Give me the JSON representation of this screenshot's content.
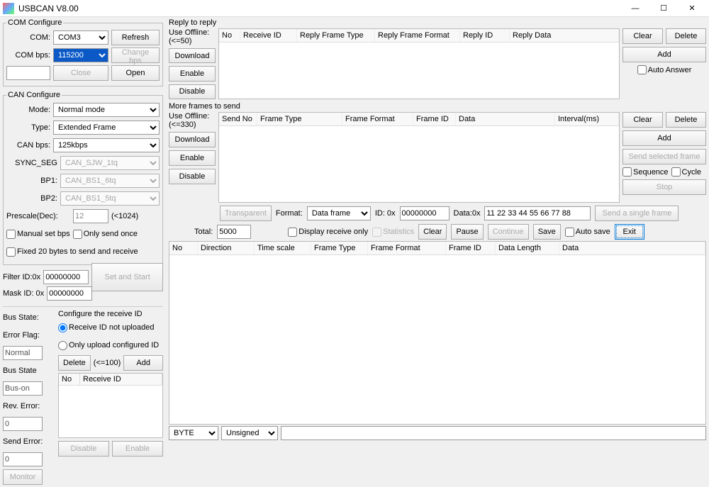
{
  "window": {
    "title": "USBCAN V8.00",
    "min": "—",
    "max": "☐",
    "close": "✕"
  },
  "com_configure": {
    "legend": "COM Configure",
    "com_label": "COM:",
    "com_value": "COM3",
    "bps_label": "COM bps:",
    "bps_value": "115200",
    "refresh": "Refresh",
    "change_bps": "Change bps",
    "close": "Close",
    "open": "Open"
  },
  "can_configure": {
    "legend": "CAN Configure",
    "mode_label": "Mode:",
    "mode_value": "Normal mode",
    "type_label": "Type:",
    "type_value": "Extended Frame",
    "canbps_label": "CAN bps:",
    "canbps_value": "125kbps",
    "sync_label": "SYNC_SEG",
    "sync_value": "CAN_SJW_1tq",
    "bp1_label": "BP1:",
    "bp1_value": "CAN_BS1_6tq",
    "bp2_label": "BP2:",
    "bp2_value": "CAN_BS1_5tq",
    "prescale_label": "Prescale(Dec):",
    "prescale_value": "12",
    "prescale_hint": "(<1024)",
    "manual_set_bps": "Manual set bps",
    "only_send_once": "Only send once",
    "fixed20": "Fixed 20 bytes to send and receive"
  },
  "filter": {
    "filter_label": "Filter ID:0x",
    "filter_value": "00000000",
    "mask_label": "Mask ID: 0x",
    "mask_value": "00000000",
    "set_start": "Set and Start"
  },
  "bus": {
    "bus_state_label": "Bus State:",
    "error_flag_label": "Error Flag:",
    "normal": "Normal",
    "bus_state2_label": "Bus State",
    "bus_on": "Bus-on",
    "rev_err_label": "Rev. Error:",
    "rev_err": "0",
    "send_err_label": "Send Error:",
    "send_err": "0",
    "monitor": "Monitor"
  },
  "receive_cfg": {
    "legend_text": "Configure the receive ID",
    "opt1": "Receive ID not uploaded",
    "opt2": "Only upload configured ID",
    "delete": "Delete",
    "hint": "(<=100)",
    "add": "Add",
    "disable": "Disable",
    "enable": "Enable",
    "col_no": "No",
    "col_recvid": "Receive ID"
  },
  "reply": {
    "legend": "Reply to reply",
    "use_offline": "Use Offline:",
    "limit": "(<=50)",
    "download": "Download",
    "enable": "Enable",
    "disable": "Disable",
    "col_no": "No",
    "col_recvid": "Receive ID",
    "col_rft": "Reply Frame Type",
    "col_rff": "Reply Frame Format",
    "col_rid": "Reply  ID",
    "col_rdata": "Reply Data",
    "clear": "Clear",
    "delete": "Delete",
    "add": "Add",
    "auto_answer": "Auto Answer"
  },
  "more_frames": {
    "legend": "More frames to send",
    "use_offline": "Use Offline:",
    "limit": "(<=330)",
    "download": "Download",
    "enable": "Enable",
    "disable": "Disable",
    "col_sendno": "Send No",
    "col_ft": "Frame Type",
    "col_ff": "Frame Format",
    "col_fid": "Frame ID",
    "col_data": "Data",
    "col_interval": "Interval(ms)",
    "clear": "Clear",
    "delete": "Delete",
    "add": "Add",
    "send_selected": "Send selected frame",
    "sequence": "Sequence",
    "cycle": "Cycle",
    "stop": "Stop"
  },
  "single": {
    "transparent": "Transparent",
    "format_label": "Format:",
    "format_value": "Data frame",
    "id_label": "ID: 0x",
    "id_value": "00000000",
    "data_label": "Data:0x",
    "data_value": "11 22 33 44 55 66 77 88",
    "send_single": "Send a single frame"
  },
  "monitor_panel": {
    "total_label": "Total:",
    "total_value": "5000",
    "display_receive": "Display receive only",
    "statistics": "Statistics",
    "clear": "Clear",
    "pause": "Pause",
    "continue": "Continue",
    "save": "Save",
    "auto_save": "Auto save",
    "exit": "Exit",
    "col_no": "No",
    "col_dir": "Direction",
    "col_ts": "Time scale",
    "col_ft": "Frame Type",
    "col_ff": "Frame Format",
    "col_fid": "Frame ID",
    "col_dl": "Data Length",
    "col_data": "Data"
  },
  "bottom": {
    "byte": "BYTE",
    "unsigned": "Unsigned"
  }
}
